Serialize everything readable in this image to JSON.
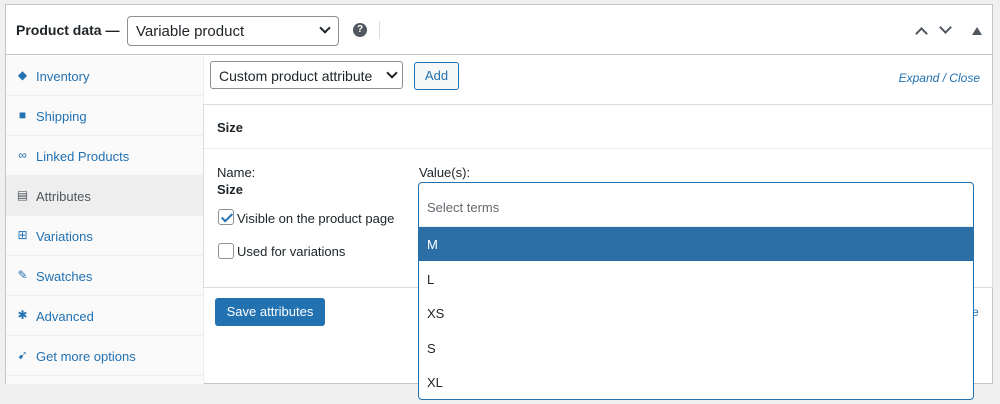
{
  "header": {
    "title": "Product data —",
    "product_type": "Variable product",
    "help_glyph": "?"
  },
  "tabs": [
    {
      "label": "Inventory",
      "icon": "tag-icon"
    },
    {
      "label": "Shipping",
      "icon": "truck-icon"
    },
    {
      "label": "Linked Products",
      "icon": "link-icon"
    },
    {
      "label": "Attributes",
      "icon": "list-icon",
      "active": true
    },
    {
      "label": "Variations",
      "icon": "grid-icon"
    },
    {
      "label": "Swatches",
      "icon": "swatches-icon"
    },
    {
      "label": "Advanced",
      "icon": "gear-icon"
    },
    {
      "label": "Get more options",
      "icon": "plugin-icon"
    }
  ],
  "toolbar": {
    "attribute_select": "Custom product attribute",
    "add_label": "Add",
    "expand_close": "Expand / Close"
  },
  "attribute": {
    "name": "Size",
    "name_label": "Name:",
    "name_value": "Size",
    "values_label": "Value(s):",
    "visible_label": "Visible on the product page",
    "visible_checked": true,
    "variations_label": "Used for variations",
    "variations_checked": false
  },
  "dropdown": {
    "placeholder": "Select terms",
    "options": [
      "M",
      "L",
      "XS",
      "S",
      "XL"
    ],
    "highlighted": "M"
  },
  "actions": {
    "save_label": "Save attributes",
    "cut_link": "e"
  },
  "colors": {
    "accent": "#2271b1",
    "highlight": "#2c6fa7"
  }
}
